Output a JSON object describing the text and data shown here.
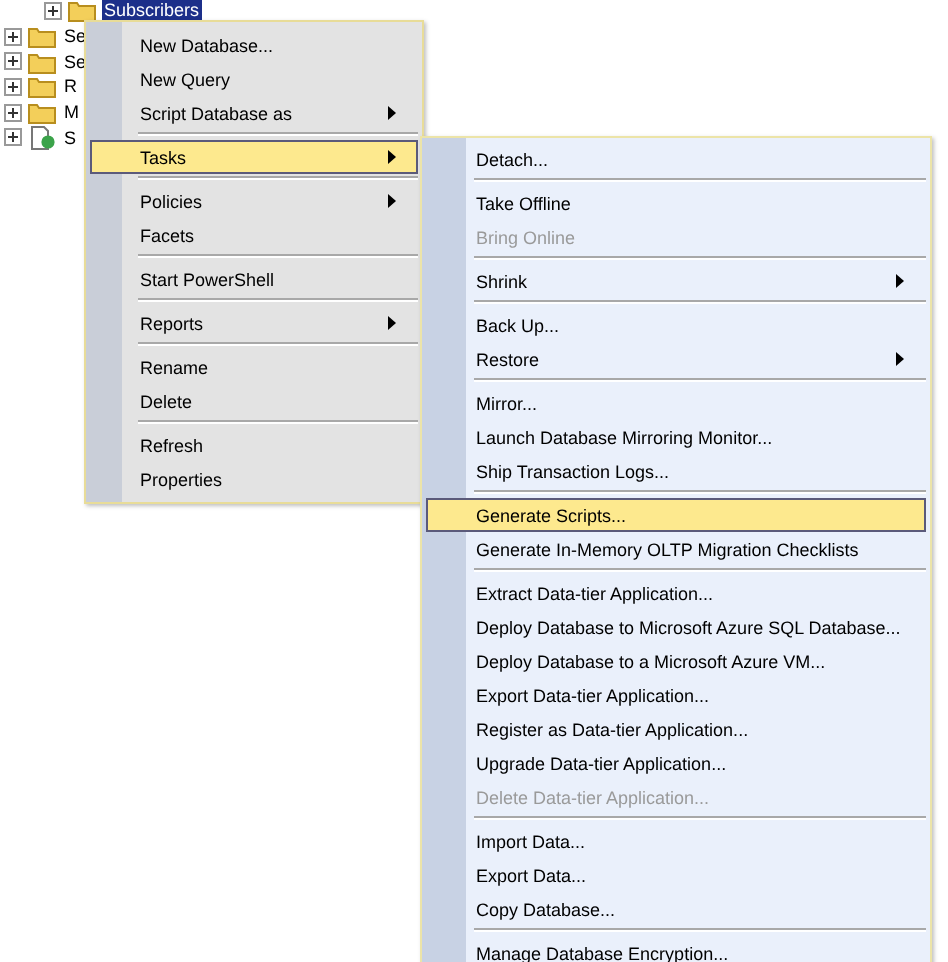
{
  "tree": {
    "nodes": [
      {
        "label": "Subscribers",
        "selected": true,
        "kind": "folder"
      },
      {
        "label": "Se",
        "selected": false,
        "kind": "folder"
      },
      {
        "label": "Se",
        "selected": false,
        "kind": "folder"
      },
      {
        "label": "R",
        "selected": false,
        "kind": "folder"
      },
      {
        "label": "M",
        "selected": false,
        "kind": "folder"
      },
      {
        "label": "S",
        "selected": false,
        "kind": "agent"
      }
    ]
  },
  "context_menu": {
    "items": [
      {
        "kind": "item",
        "label": "New Database...",
        "submenu": false,
        "disabled": false,
        "selected": false
      },
      {
        "kind": "item",
        "label": "New Query",
        "submenu": false,
        "disabled": false,
        "selected": false
      },
      {
        "kind": "item",
        "label": "Script Database as",
        "submenu": true,
        "disabled": false,
        "selected": false
      },
      {
        "kind": "separator"
      },
      {
        "kind": "item",
        "label": "Tasks",
        "submenu": true,
        "disabled": false,
        "selected": true
      },
      {
        "kind": "separator"
      },
      {
        "kind": "item",
        "label": "Policies",
        "submenu": true,
        "disabled": false,
        "selected": false
      },
      {
        "kind": "item",
        "label": "Facets",
        "submenu": false,
        "disabled": false,
        "selected": false
      },
      {
        "kind": "separator"
      },
      {
        "kind": "item",
        "label": "Start PowerShell",
        "submenu": false,
        "disabled": false,
        "selected": false
      },
      {
        "kind": "separator"
      },
      {
        "kind": "item",
        "label": "Reports",
        "submenu": true,
        "disabled": false,
        "selected": false
      },
      {
        "kind": "separator"
      },
      {
        "kind": "item",
        "label": "Rename",
        "submenu": false,
        "disabled": false,
        "selected": false
      },
      {
        "kind": "item",
        "label": "Delete",
        "submenu": false,
        "disabled": false,
        "selected": false
      },
      {
        "kind": "separator"
      },
      {
        "kind": "item",
        "label": "Refresh",
        "submenu": false,
        "disabled": false,
        "selected": false
      },
      {
        "kind": "item",
        "label": "Properties",
        "submenu": false,
        "disabled": false,
        "selected": false
      }
    ]
  },
  "tasks_submenu": {
    "items": [
      {
        "kind": "item",
        "label": "Detach...",
        "submenu": false,
        "disabled": false,
        "selected": false
      },
      {
        "kind": "separator"
      },
      {
        "kind": "item",
        "label": "Take Offline",
        "submenu": false,
        "disabled": false,
        "selected": false
      },
      {
        "kind": "item",
        "label": "Bring Online",
        "submenu": false,
        "disabled": true,
        "selected": false
      },
      {
        "kind": "separator"
      },
      {
        "kind": "item",
        "label": "Shrink",
        "submenu": true,
        "disabled": false,
        "selected": false
      },
      {
        "kind": "separator"
      },
      {
        "kind": "item",
        "label": "Back Up...",
        "submenu": false,
        "disabled": false,
        "selected": false
      },
      {
        "kind": "item",
        "label": "Restore",
        "submenu": true,
        "disabled": false,
        "selected": false
      },
      {
        "kind": "separator"
      },
      {
        "kind": "item",
        "label": "Mirror...",
        "submenu": false,
        "disabled": false,
        "selected": false
      },
      {
        "kind": "item",
        "label": "Launch Database Mirroring Monitor...",
        "submenu": false,
        "disabled": false,
        "selected": false
      },
      {
        "kind": "item",
        "label": "Ship Transaction Logs...",
        "submenu": false,
        "disabled": false,
        "selected": false
      },
      {
        "kind": "separator"
      },
      {
        "kind": "item",
        "label": "Generate Scripts...",
        "submenu": false,
        "disabled": false,
        "selected": true
      },
      {
        "kind": "item",
        "label": "Generate In-Memory OLTP Migration Checklists",
        "submenu": false,
        "disabled": false,
        "selected": false
      },
      {
        "kind": "separator"
      },
      {
        "kind": "item",
        "label": "Extract Data-tier Application...",
        "submenu": false,
        "disabled": false,
        "selected": false
      },
      {
        "kind": "item",
        "label": "Deploy Database to Microsoft Azure SQL Database...",
        "submenu": false,
        "disabled": false,
        "selected": false
      },
      {
        "kind": "item",
        "label": "Deploy Database to a Microsoft Azure VM...",
        "submenu": false,
        "disabled": false,
        "selected": false
      },
      {
        "kind": "item",
        "label": "Export Data-tier Application...",
        "submenu": false,
        "disabled": false,
        "selected": false
      },
      {
        "kind": "item",
        "label": "Register as Data-tier Application...",
        "submenu": false,
        "disabled": false,
        "selected": false
      },
      {
        "kind": "item",
        "label": "Upgrade Data-tier Application...",
        "submenu": false,
        "disabled": false,
        "selected": false
      },
      {
        "kind": "item",
        "label": "Delete Data-tier Application...",
        "submenu": false,
        "disabled": true,
        "selected": false
      },
      {
        "kind": "separator"
      },
      {
        "kind": "item",
        "label": "Import Data...",
        "submenu": false,
        "disabled": false,
        "selected": false
      },
      {
        "kind": "item",
        "label": "Export Data...",
        "submenu": false,
        "disabled": false,
        "selected": false
      },
      {
        "kind": "item",
        "label": "Copy Database...",
        "submenu": false,
        "disabled": false,
        "selected": false
      },
      {
        "kind": "separator"
      },
      {
        "kind": "item",
        "label": "Manage Database Encryption...",
        "submenu": false,
        "disabled": false,
        "selected": false
      }
    ]
  }
}
